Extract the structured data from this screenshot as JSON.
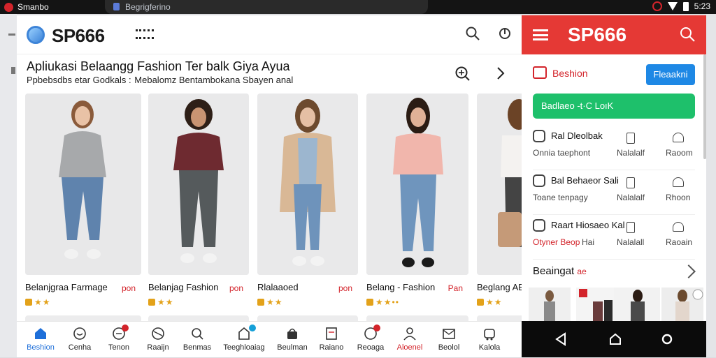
{
  "status_bar": {
    "app_name": "Smanbo",
    "tab_title": "Begrigferino",
    "time": "5:23"
  },
  "main": {
    "brand": "SP666",
    "section": {
      "title": "Apliukasi Belaangg Fashion Ter balk Giya Ayua",
      "subtitle": "Ppbebsdbs etar Godkals :  Mebalomz Bentambokana Sbayen anal"
    },
    "products": [
      {
        "name": "Belanjgraa Farmage",
        "price": "pon",
        "rating": "★★"
      },
      {
        "name": "Belanjag Fashion",
        "price": "pon",
        "rating": "★★"
      },
      {
        "name": "Rlalaaoed",
        "price": "pon",
        "rating": "★★"
      },
      {
        "name": "Belang - Fashion",
        "price": "Pan",
        "rating": "★★••"
      },
      {
        "name": "Beglang AE",
        "price": "",
        "rating": "★★"
      }
    ],
    "nav": [
      {
        "label": "Beshion",
        "icon": "home-icon",
        "active": true
      },
      {
        "label": "Cenha",
        "icon": "chat-icon"
      },
      {
        "label": "Tenon",
        "icon": "tag-icon",
        "badge": true
      },
      {
        "label": "Raaijn",
        "icon": "basket-icon"
      },
      {
        "label": "Benmas",
        "icon": "search-icon"
      },
      {
        "label": "Teeghloaiag",
        "icon": "store-icon",
        "badge": true
      },
      {
        "label": "Beulman",
        "icon": "bag-icon"
      },
      {
        "label": "Raiano",
        "icon": "receipt-icon"
      },
      {
        "label": "Reoaga",
        "icon": "chat-bubble-icon",
        "badge": true
      },
      {
        "label": "Aloenel",
        "icon": "user-icon"
      },
      {
        "label": "Beolol",
        "icon": "mail-icon"
      },
      {
        "label": "Kalola",
        "icon": "cart-icon"
      }
    ]
  },
  "phone": {
    "brand": "SP666",
    "row1_label": "Beshion",
    "row1_button": "Fleaakni",
    "green_button": "Badlaeo -t·C LoıK",
    "items": [
      {
        "title": "Ral Dleolbak",
        "sub": "Onnia taephont",
        "col2": "Nalalalf",
        "col3": "Raoom"
      },
      {
        "title": "Bal Behaeor Sali",
        "sub": "Toane tenpagy",
        "col2": "Nalalalf",
        "col3": "Rhoon"
      },
      {
        "title": "Raart Hiosaeo Kal",
        "sub": "Otyner Beop",
        "sub2": "Hai",
        "col2": "Nalalall",
        "col3": "Raoain"
      }
    ],
    "shop_title": "Beaingat",
    "shop_tag": "ae"
  },
  "colors": {
    "accent_red": "#e53935",
    "accent_blue": "#1e88e5",
    "accent_green": "#1ec06b"
  }
}
